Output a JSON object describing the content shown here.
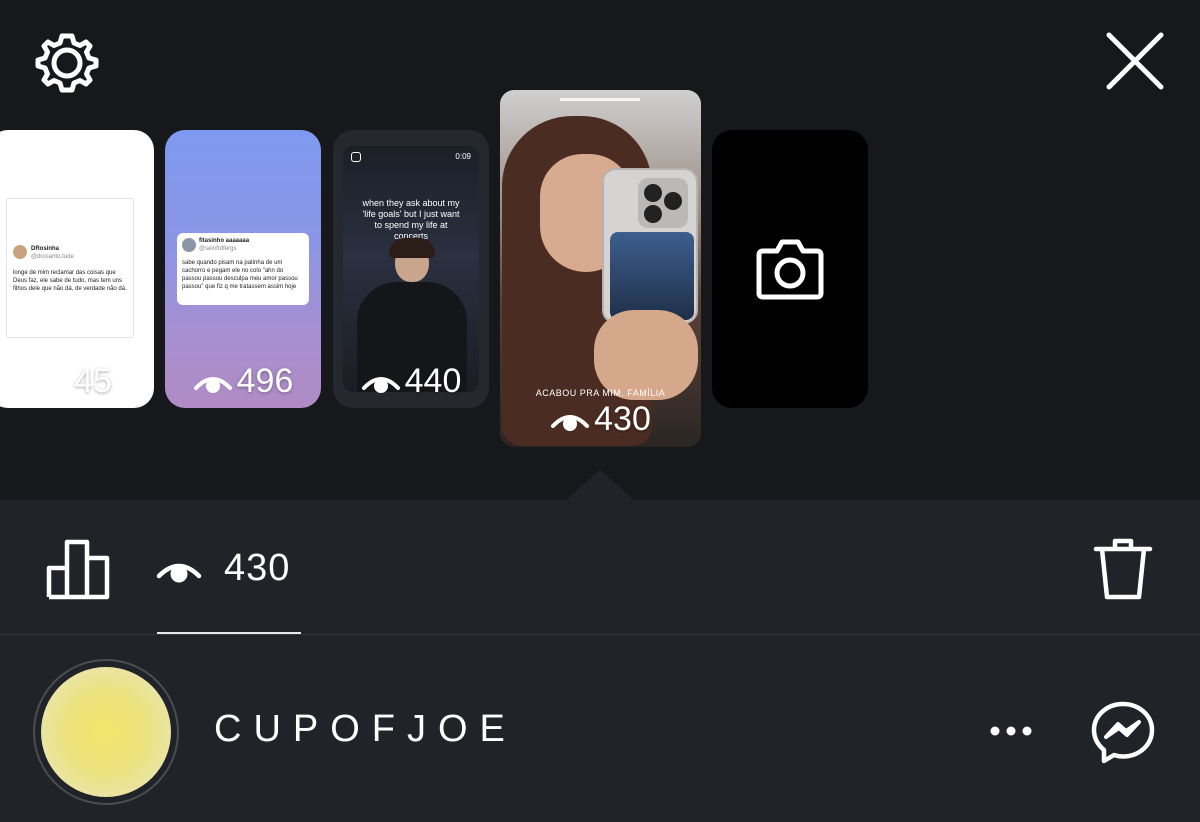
{
  "stories": [
    {
      "views": "45",
      "tweet_name": "DRosinha",
      "tweet_handle": "@drosarito.tude",
      "tweet_text": "longe de mim reclamar das coisas que Deus faz, ele sabe de tudo, mas tem uns filhos dele que não dá, de verdade não dá."
    },
    {
      "views": "496",
      "tweet_name": "fitasinho aaaaaaa",
      "tweet_handle": "@seinfrdfergs",
      "tweet_text": "sabe quando pisam na patinha de um cachorro e pegam ele no colo \"ahn do passou passou desculpa meu amor passou passou\" que fiz q me tratassem assim hoje"
    },
    {
      "views": "440",
      "timer": "0:09",
      "caption": "when they ask about my 'life goals' but I just want to spend my life at concerts"
    },
    {
      "views": "430",
      "caption": "ACABOU PRA MIM. FAMÍLIA"
    }
  ],
  "stats": {
    "view_count": "430"
  },
  "user": {
    "username": "CUPOFJOE"
  },
  "colors": {
    "background": "#16181c",
    "panel": "#202328",
    "avatar": "#f0e46e"
  },
  "icons": [
    "gear-icon",
    "close-icon",
    "eye-icon",
    "camera-icon",
    "bar-chart-icon",
    "trash-icon",
    "more-icon",
    "messenger-icon"
  ]
}
